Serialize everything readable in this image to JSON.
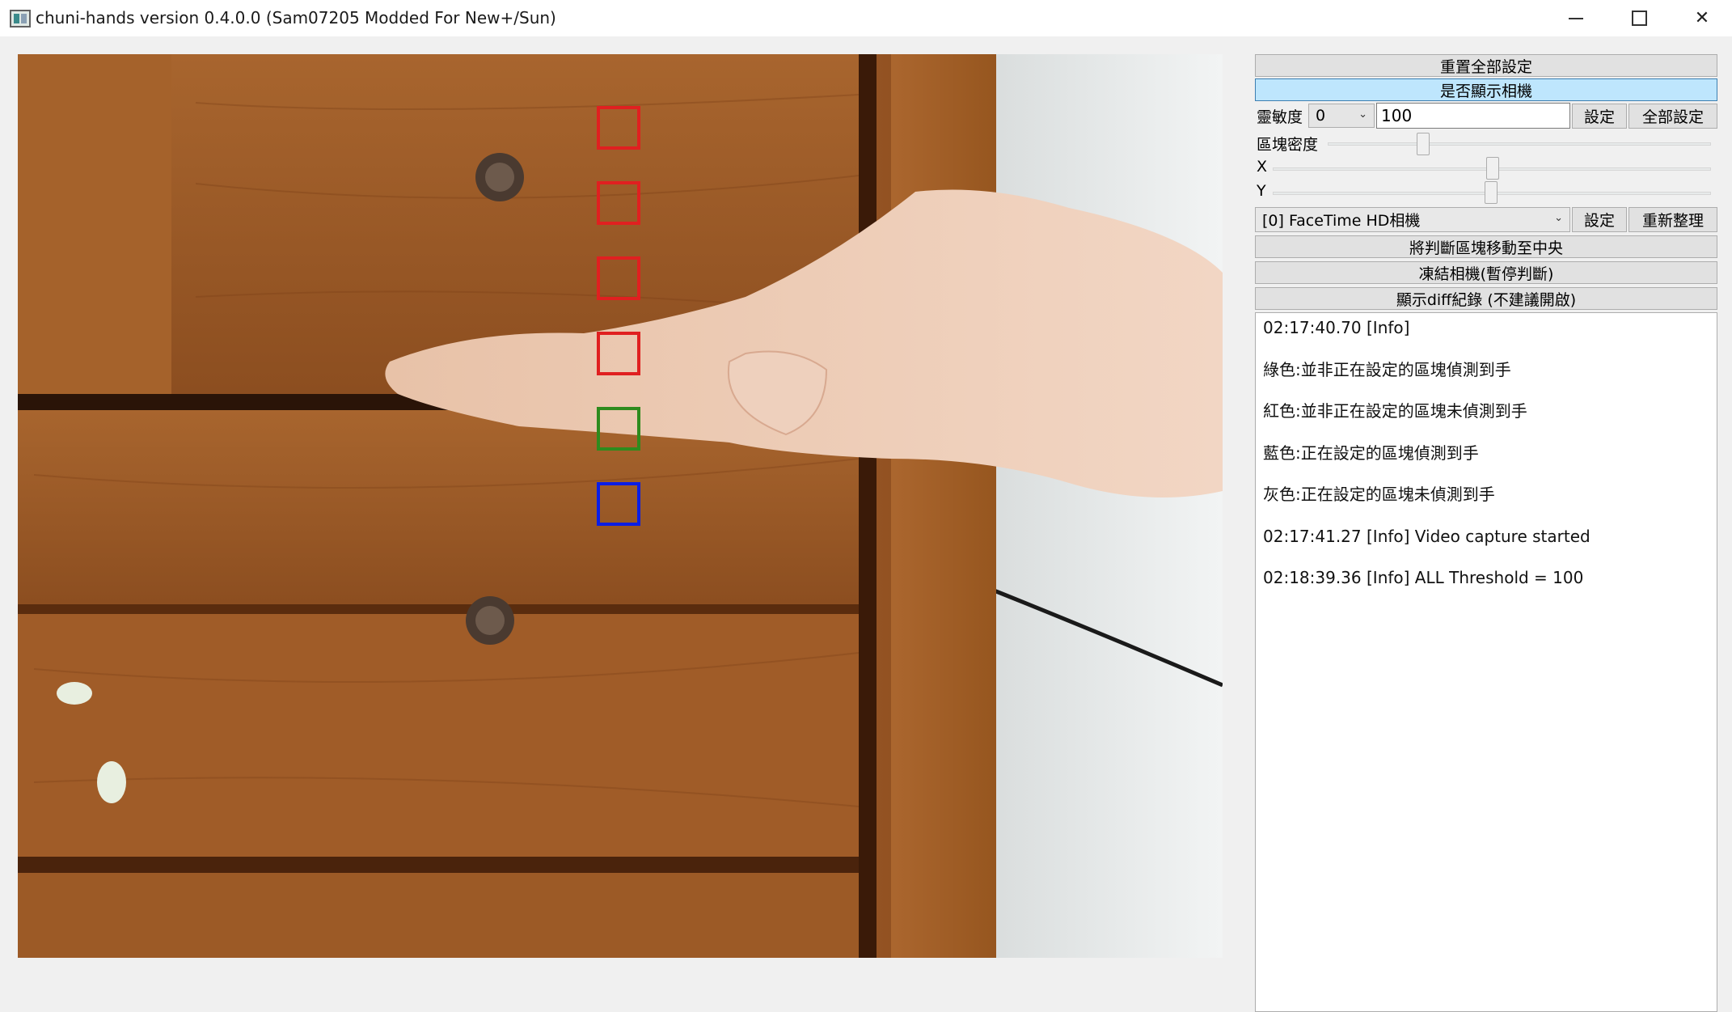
{
  "window": {
    "title": "chuni-hands version 0.4.0.0 (Sam07205 Modded For New+/Sun)"
  },
  "camera_view": {
    "zone_colors": [
      "#e02020",
      "#e02020",
      "#e02020",
      "#e02020",
      "#2e8b1e",
      "#0a1ee6"
    ]
  },
  "controls": {
    "reset_all_label": "重置全部設定",
    "show_camera_label": "是否顯示相機",
    "sensitivity_label": "靈敏度",
    "zone_select_value": "0",
    "threshold_value": "100",
    "set_label": "設定",
    "set_all_label": "全部設定",
    "zone_density_label": "區塊密度",
    "x_label": "X",
    "y_label": "Y",
    "camera_select_value": "[0] FaceTime HD相機",
    "camera_set_label": "設定",
    "refresh_label": "重新整理",
    "center_zones_label": "將判斷區塊移動至中央",
    "freeze_camera_label": "凍結相機(暫停判斷)",
    "show_diff_label": "顯示diff紀錄 (不建議開啟)"
  },
  "log": {
    "lines": [
      "02:17:40.70 [Info]",
      "綠色:並非正在設定的區塊偵測到手",
      "紅色:並非正在設定的區塊未偵測到手",
      "藍色:正在設定的區塊偵測到手",
      "灰色:正在設定的區塊未偵測到手",
      "02:17:41.27 [Info] Video capture started",
      "02:18:39.36 [Info] ALL Threshold = 100"
    ]
  }
}
